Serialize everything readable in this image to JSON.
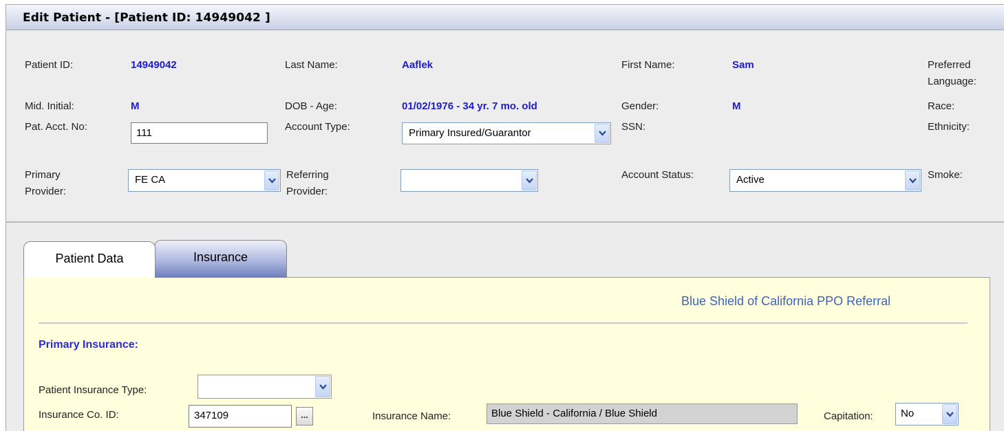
{
  "window": {
    "title": "Edit Patient - [Patient ID: 14949042 ]"
  },
  "header": {
    "patient_id_label": "Patient ID:",
    "patient_id_value": "14949042",
    "last_name_label": "Last Name:",
    "last_name_value": "Aaflek",
    "first_name_label": "First Name:",
    "first_name_value": "Sam",
    "preferred_language_label_1": "Preferred",
    "preferred_language_label_2": "Language:",
    "mid_initial_label": "Mid. Initial:",
    "mid_initial_value": "M",
    "dob_age_label": "DOB - Age:",
    "dob_age_value": "01/02/1976 - 34 yr. 7 mo. old",
    "gender_label": "Gender:",
    "gender_value": "M",
    "race_label": "Race:",
    "pat_acct_label": "Pat. Acct. No:",
    "pat_acct_value": "111",
    "account_type_label": "Account Type:",
    "account_type_value": "Primary Insured/Guarantor",
    "ssn_label": "SSN:",
    "ethnicity_label": "Ethnicity:",
    "primary_provider_label_1": "Primary",
    "primary_provider_label_2": "Provider:",
    "primary_provider_value": "FE CA",
    "referring_provider_label_1": "Referring",
    "referring_provider_label_2": "Provider:",
    "referring_provider_value": "",
    "account_status_label": "Account Status:",
    "account_status_value": "Active",
    "smoke_label": "Smoke:"
  },
  "tabs": [
    {
      "label": "Patient Data",
      "active": true
    },
    {
      "label": "Insurance",
      "active": false
    }
  ],
  "insurance": {
    "plan_link": "Blue Shield of California PPO Referral",
    "section_title": "Primary Insurance:",
    "patient_insurance_type_label": "Patient Insurance Type:",
    "patient_insurance_type_value": "",
    "insurance_co_id_label": "Insurance Co. ID:",
    "insurance_co_id_value": "347109",
    "lookup_button": "...",
    "insurance_name_label": "Insurance Name:",
    "insurance_name_value": "Blue Shield - California / Blue Shield",
    "capitation_label": "Capitation:",
    "capitation_value": "No"
  },
  "colors": {
    "value_blue": "#1c1ccc",
    "link_blue": "#3f64b7",
    "panel_yellow": "#ffffdd",
    "active_tab_bg": "#ffffff",
    "inactive_tab_bg": "#7b8ac4"
  }
}
